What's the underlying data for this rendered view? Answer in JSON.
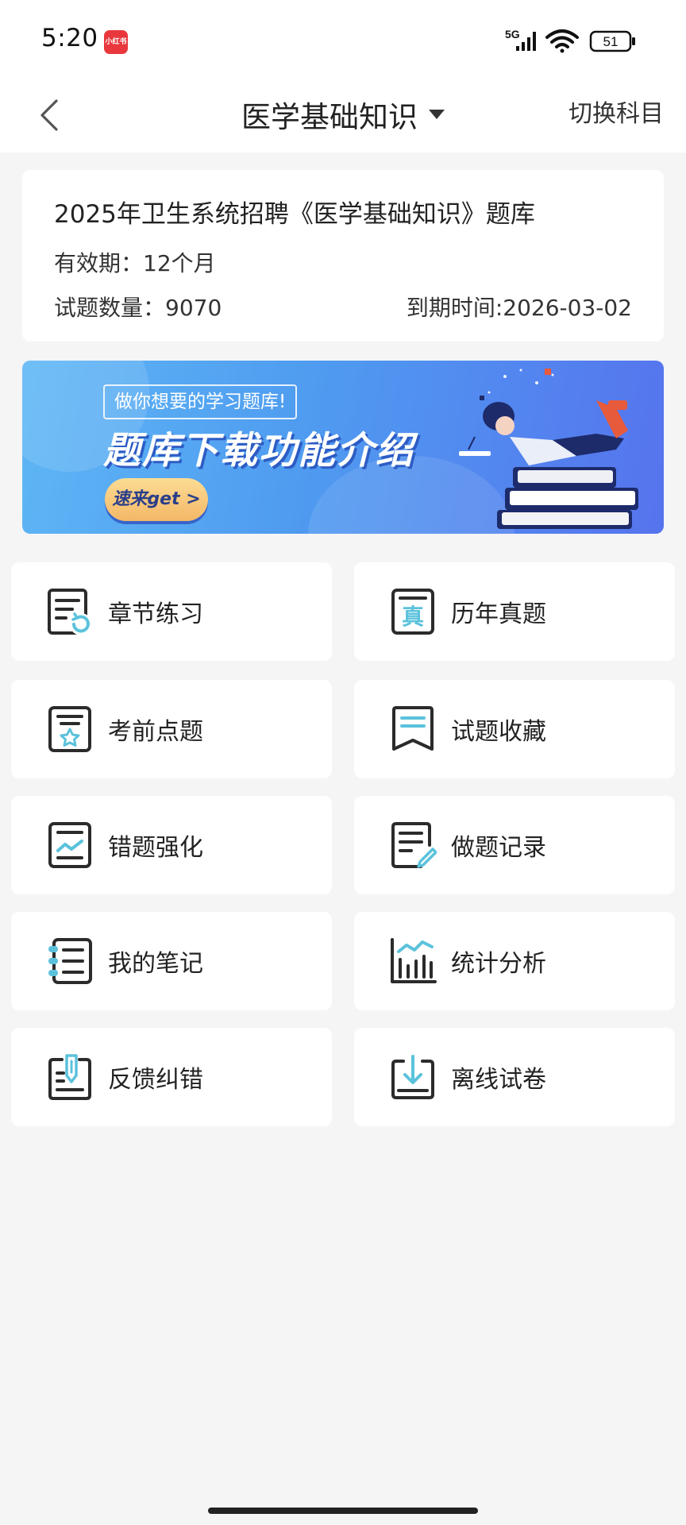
{
  "status_bar": {
    "time": "5:20",
    "app_badge": "小红书",
    "network": "5G",
    "battery": "51"
  },
  "nav": {
    "title": "医学基础知识",
    "switch_label": "切换科目"
  },
  "info": {
    "title": "2025年卫生系统招聘《医学基础知识》题库",
    "validity": "有效期：12个月",
    "count": "试题数量：9070",
    "expire": "到期时间:2026-03-02"
  },
  "banner": {
    "subtitle": "做你想要的学习题库!",
    "title": "题库下载功能介绍",
    "cta": "速来get >"
  },
  "menu": [
    {
      "label": "章节练习",
      "icon": "chapter-practice-icon"
    },
    {
      "label": "历年真题",
      "icon": "past-exams-icon"
    },
    {
      "label": "考前点题",
      "icon": "pre-exam-tips-icon"
    },
    {
      "label": "试题收藏",
      "icon": "bookmark-icon"
    },
    {
      "label": "错题强化",
      "icon": "wrong-questions-icon"
    },
    {
      "label": "做题记录",
      "icon": "practice-record-icon"
    },
    {
      "label": "我的笔记",
      "icon": "notes-icon"
    },
    {
      "label": "统计分析",
      "icon": "statistics-icon"
    },
    {
      "label": "反馈纠错",
      "icon": "feedback-icon"
    },
    {
      "label": "离线试卷",
      "icon": "offline-paper-icon"
    }
  ],
  "colors": {
    "accent": "#5bc2dc",
    "icon_dark": "#2b2b2b",
    "background": "#f5f5f6"
  }
}
